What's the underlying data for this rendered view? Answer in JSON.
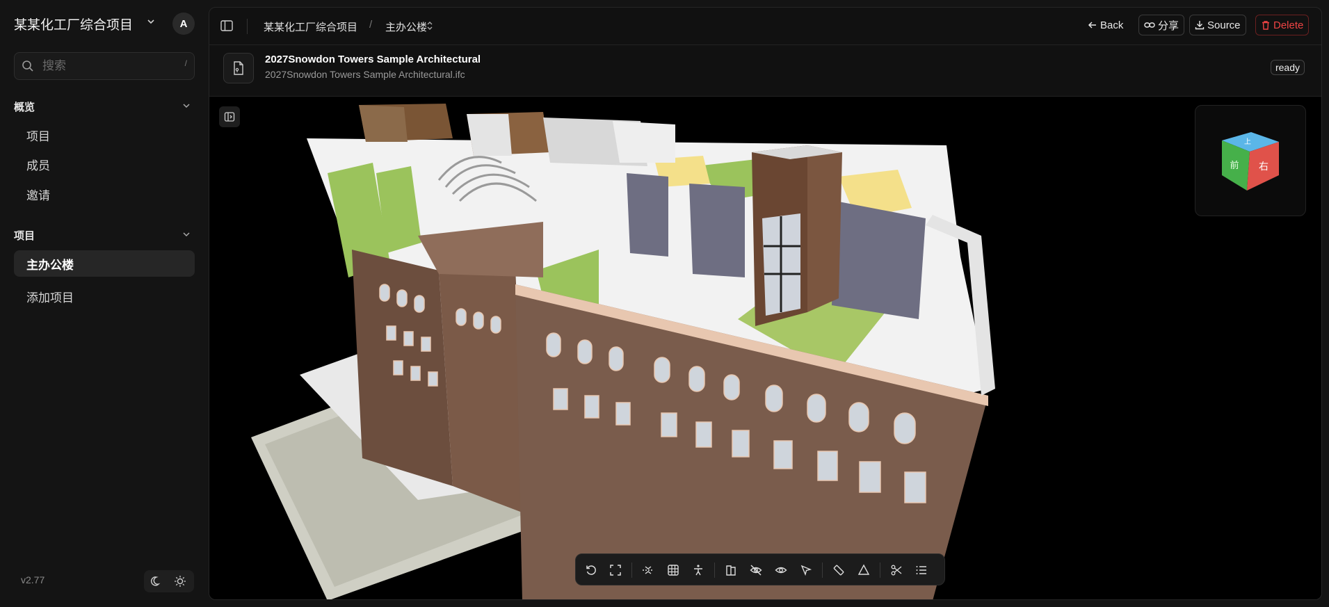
{
  "sidebar": {
    "project_name": "某某化工厂综合项目",
    "avatar_initial": "A",
    "search_placeholder": "搜索",
    "search_shortcut": "/",
    "sections": [
      {
        "title": "概览",
        "items": [
          "项目",
          "成员",
          "邀请"
        ]
      },
      {
        "title": "项目",
        "items": [
          "主办公楼",
          "添加项目"
        ],
        "active": "主办公楼"
      }
    ],
    "version": "v2.77"
  },
  "topbar": {
    "breadcrumb": [
      "某某化工厂综合项目",
      "主办公楼"
    ],
    "back_label": "Back",
    "share_label": "分享",
    "source_label": "Source",
    "delete_label": "Delete"
  },
  "file": {
    "title": "2027Snowdon Towers Sample Architectural",
    "filename": "2027Snowdon Towers Sample Architectural.ifc",
    "status": "ready"
  },
  "nav_cube": {
    "face_top": "上",
    "face_front": "前",
    "face_right": "右"
  },
  "colors": {
    "background": "#141414",
    "panel": "#111111",
    "danger": "#ef4444",
    "cube_top": "#5bb6e8",
    "cube_front": "#46b04a",
    "cube_right": "#e0524a"
  },
  "toolbar": {
    "tools": [
      "rotate-icon",
      "fit-view-icon",
      "section-plane-icon",
      "grid-icon",
      "walk-mode-icon",
      "floor-plan-icon",
      "hide-icon",
      "show-all-icon",
      "select-icon",
      "measure-icon",
      "area-measure-icon",
      "clip-icon",
      "list-icon"
    ]
  }
}
